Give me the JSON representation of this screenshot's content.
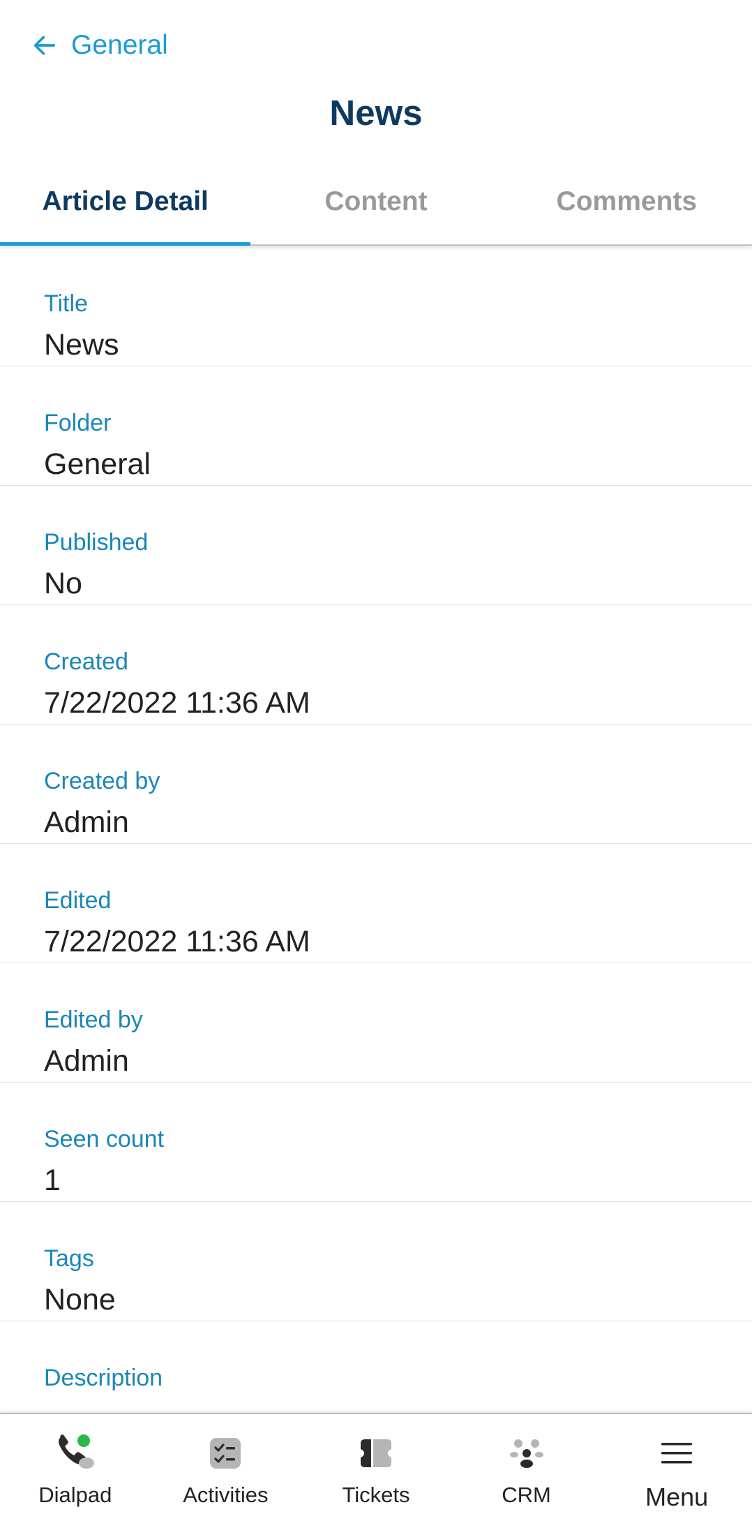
{
  "header": {
    "back_label": "General",
    "title": "News"
  },
  "tabs": [
    {
      "label": "Article Detail",
      "active": true
    },
    {
      "label": "Content",
      "active": false
    },
    {
      "label": "Comments",
      "active": false
    }
  ],
  "fields": [
    {
      "label": "Title",
      "value": "News"
    },
    {
      "label": "Folder",
      "value": "General"
    },
    {
      "label": "Published",
      "value": "No"
    },
    {
      "label": "Created",
      "value": "7/22/2022 11:36 AM"
    },
    {
      "label": "Created by",
      "value": "Admin"
    },
    {
      "label": "Edited",
      "value": "7/22/2022 11:36 AM"
    },
    {
      "label": "Edited by",
      "value": "Admin"
    },
    {
      "label": "Seen count",
      "value": "1"
    },
    {
      "label": "Tags",
      "value": "None"
    },
    {
      "label": "Description",
      "value": ""
    }
  ],
  "bottom_nav": [
    {
      "label": "Dialpad",
      "icon": "dialpad-phone-icon"
    },
    {
      "label": "Activities",
      "icon": "activities-checklist-icon"
    },
    {
      "label": "Tickets",
      "icon": "tickets-icon"
    },
    {
      "label": "CRM",
      "icon": "crm-people-icon"
    },
    {
      "label": "Menu",
      "icon": "hamburger-menu-icon"
    }
  ],
  "colors": {
    "accent": "#1a9bd3",
    "title": "#0f3a60",
    "field_label": "#1a86b8",
    "status_online": "#2db84b"
  }
}
